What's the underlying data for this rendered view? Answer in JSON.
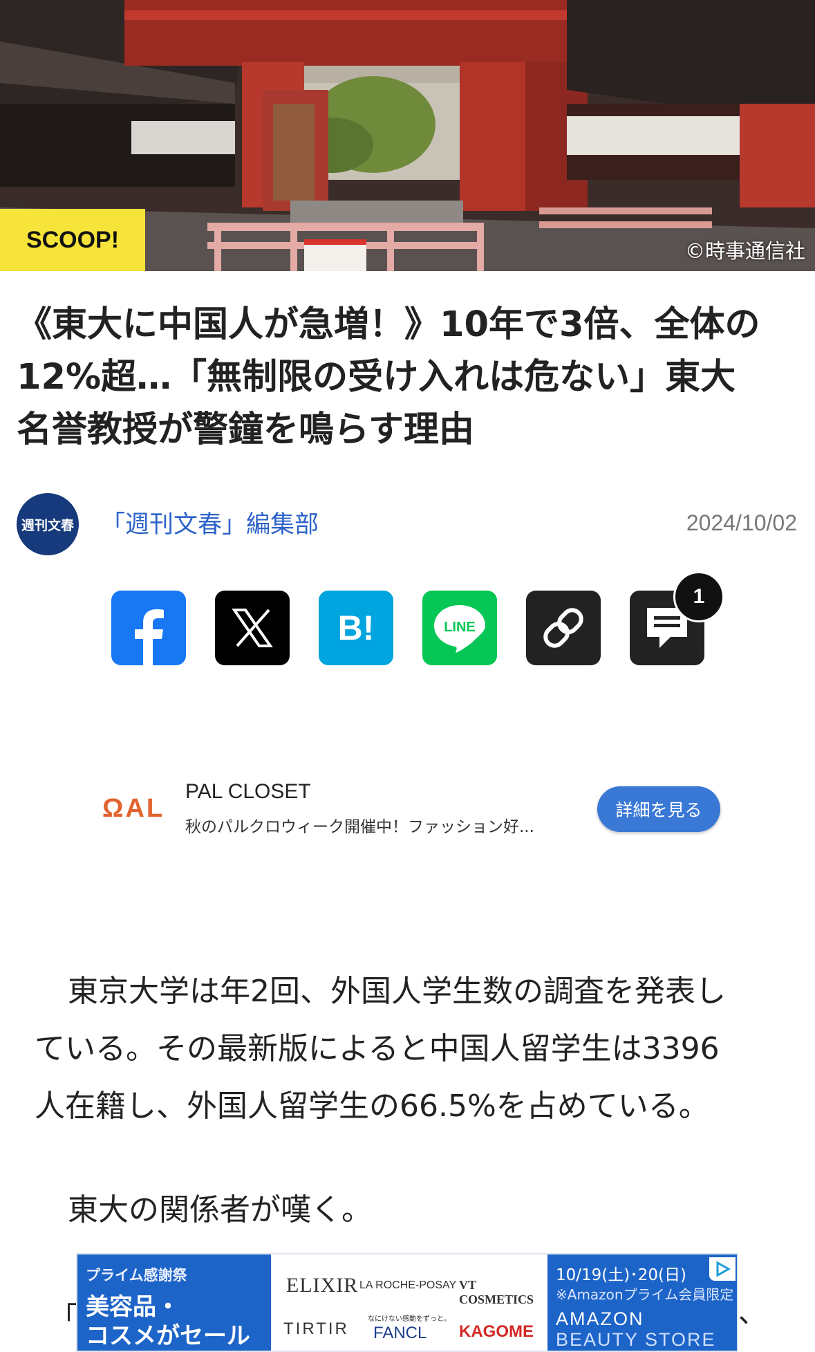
{
  "hero": {
    "badge": "SCOOP!",
    "credit": "©時事通信社",
    "colors": {
      "badge": "#f7e43a",
      "gate": "#b7382c"
    }
  },
  "article": {
    "title_lines": [
      "《東大に中国人が急増！》10年で3倍、全体の",
      "12%超…「無制限の受け入れは危ない」東大",
      "名誉教授が警鐘を鳴らす理由"
    ],
    "publisher_logo_text": "週刊文春",
    "author": "「週刊文春」編集部",
    "date": "2024/10/02"
  },
  "share": {
    "buttons": [
      {
        "name": "facebook",
        "icon": "facebook-icon",
        "color": "#1877f2"
      },
      {
        "name": "x",
        "icon": "x-icon",
        "color": "#000000"
      },
      {
        "name": "hatena",
        "icon": "hatena-bookmark-icon",
        "label": "B!",
        "color": "#00a4de"
      },
      {
        "name": "line",
        "icon": "line-icon",
        "label": "LINE",
        "color": "#06c755"
      },
      {
        "name": "copy-link",
        "icon": "link-icon",
        "color": "#222222"
      },
      {
        "name": "comments",
        "icon": "comment-icon",
        "color": "#222222"
      }
    ],
    "comment_count": "1"
  },
  "ad1": {
    "logo": "ΩAL",
    "title": "PAL CLOSET",
    "description": "秋のパルクロウィーク開催中！ファッション好...",
    "button": "詳細を見る"
  },
  "body": {
    "p1_lines": [
      "東京大学は年2回、外国人学生数の調査を発表し",
      "ている。その最新版によると中国人留学生は3396",
      "人在籍し、外国人留学生の66.5%を占めている。"
    ],
    "p2": "東大の関係者が嘆く。",
    "p3_start": "「",
    "p3_end": "、"
  },
  "ad2": {
    "left_line1": "プライム感謝祭",
    "left_line2": "美容品・",
    "left_line3": "コスメがセール",
    "brands": [
      "ELIXIR",
      "LA ROCHE-POSAY",
      "VT COSMETICS",
      "TIRTIR",
      "FANCL",
      "KAGOME"
    ],
    "fancl_tagline": "なにけない感動をずっと。",
    "right_line1": "10/19(土)･20(日)",
    "right_line2": "※Amazonプライム会員限定",
    "right_line3": "AMAZON",
    "right_line4": "BEAUTY STORE"
  }
}
